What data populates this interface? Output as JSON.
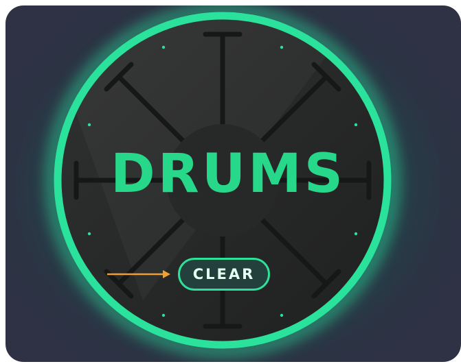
{
  "pad": {
    "title": "DRUMS",
    "clear_label": "CLEAR"
  },
  "colors": {
    "accent": "#2ee09a",
    "annotation_arrow": "#f0a030"
  },
  "icons": {
    "annotation": "arrow-right-icon"
  }
}
